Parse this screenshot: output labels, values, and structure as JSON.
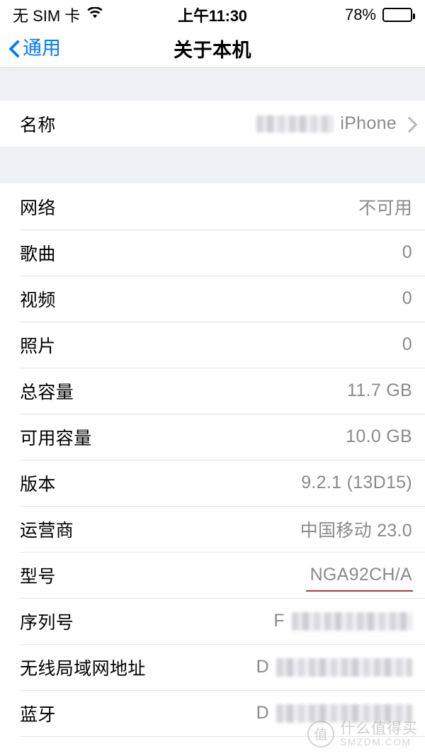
{
  "status_bar": {
    "carrier": "无 SIM 卡",
    "wifi_icon": "wifi-icon",
    "time": "上午11:30",
    "battery_percent": "78%",
    "battery_level": 78,
    "battery_icon": "battery-icon"
  },
  "nav_bar": {
    "back_label": "通用",
    "back_icon": "chevron-left-icon",
    "title": "关于本机"
  },
  "sections": [
    {
      "rows": [
        {
          "label": "名称",
          "value_prefix_redacted": true,
          "value": "iPhone",
          "accessory": "chevron-right-icon",
          "interactable": true
        }
      ]
    },
    {
      "rows": [
        {
          "label": "网络",
          "value": "不可用"
        },
        {
          "label": "歌曲",
          "value": "0"
        },
        {
          "label": "视频",
          "value": "0"
        },
        {
          "label": "照片",
          "value": "0"
        },
        {
          "label": "总容量",
          "value": "11.7 GB"
        },
        {
          "label": "可用容量",
          "value": "10.0 GB"
        },
        {
          "label": "版本",
          "value": "9.2.1 (13D15)"
        },
        {
          "label": "运营商",
          "value": "中国移动 23.0"
        },
        {
          "label": "型号",
          "value": "NGA92CH/A",
          "highlight_underline": true,
          "underline_color": "#b03a3a"
        },
        {
          "label": "序列号",
          "value_prefix": "F",
          "value_redacted": true
        },
        {
          "label": "无线局域网地址",
          "value_prefix": "D",
          "value_redacted": true
        },
        {
          "label": "蓝牙",
          "value_prefix": "D",
          "value_redacted": true
        }
      ]
    }
  ],
  "watermark": {
    "badge_glyph": "值",
    "line1": "什么值得买",
    "line2": "SMZDM.COM"
  },
  "colors": {
    "accent_blue": "#007aff",
    "value_gray": "#8a8a8e",
    "group_bg": "#eff0f4",
    "separator": "#e4e4e6",
    "underline_red": "#b03a3a"
  }
}
